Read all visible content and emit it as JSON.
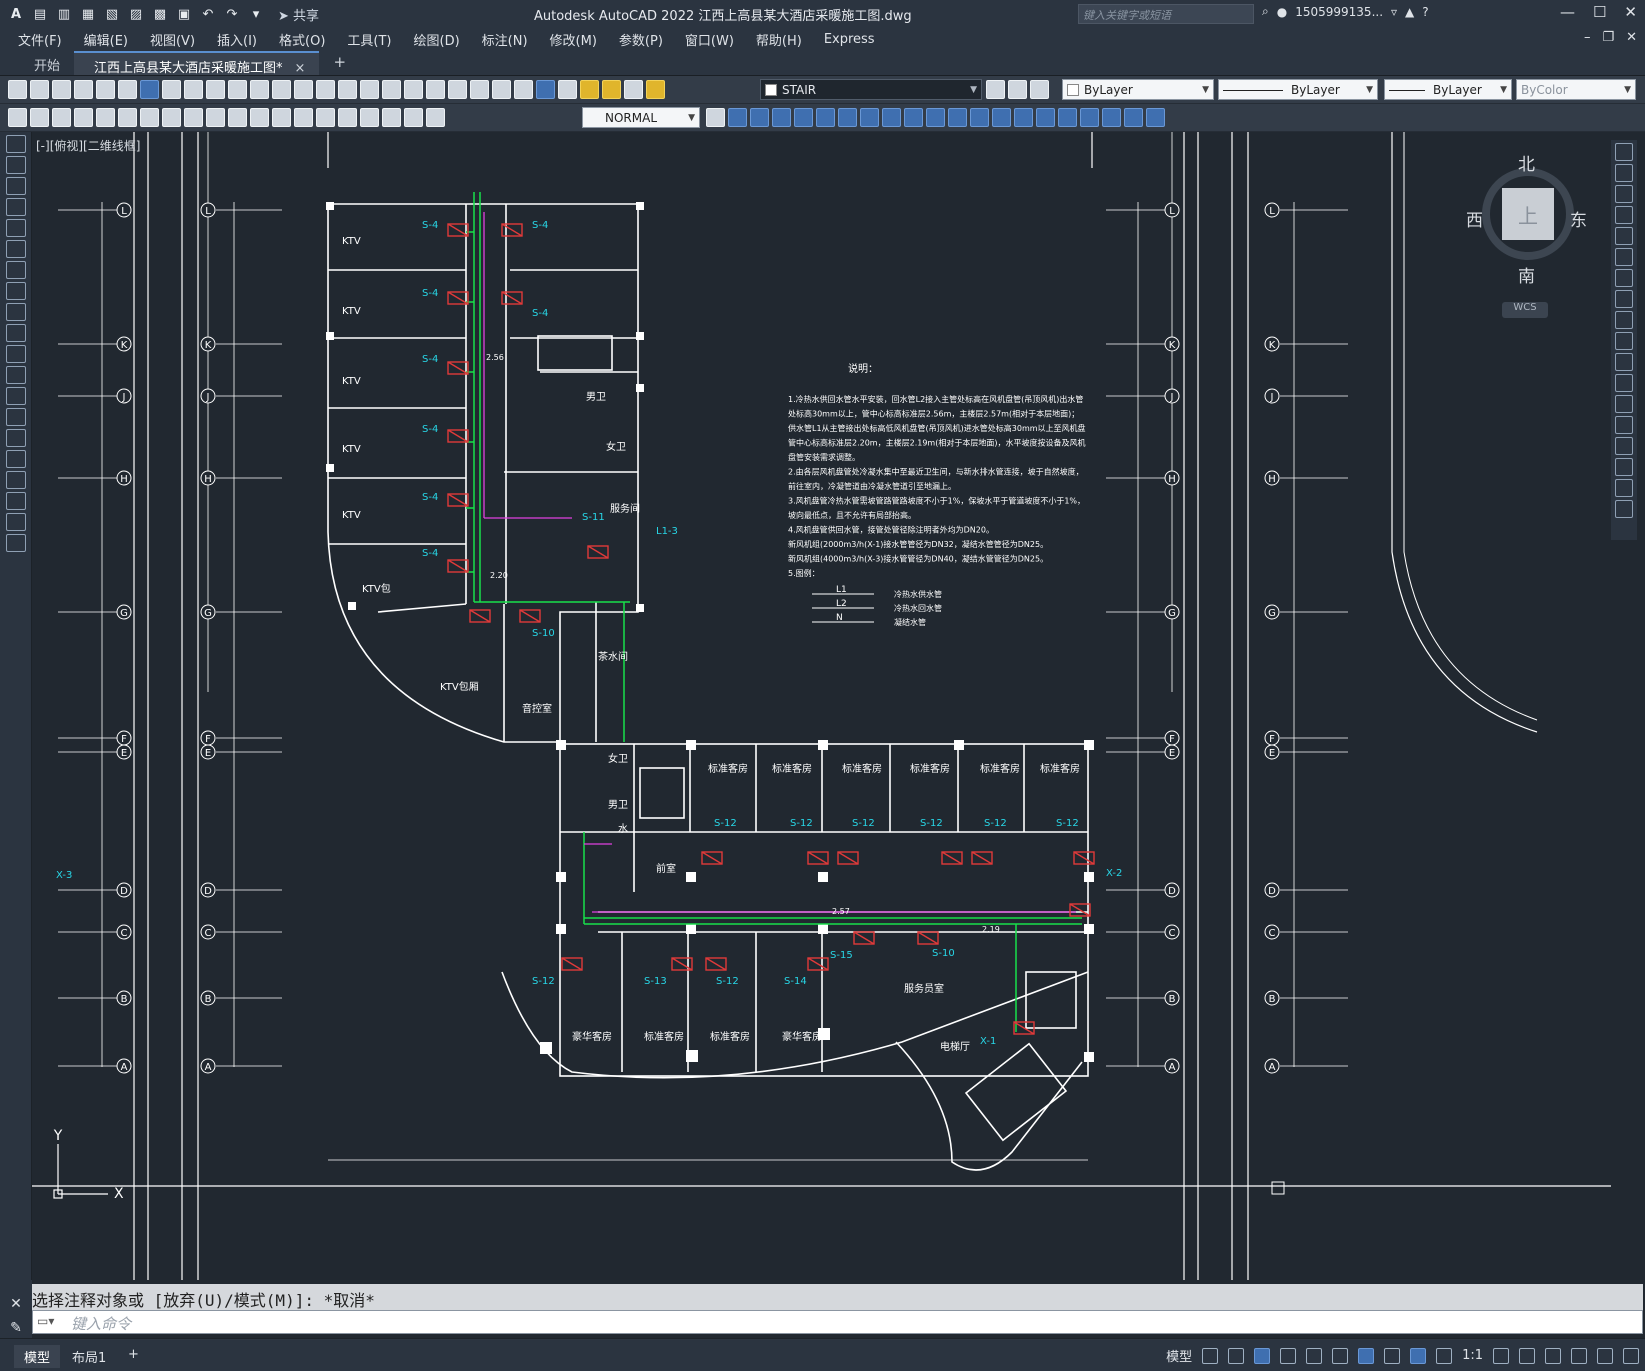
{
  "app": {
    "title": "Autodesk AutoCAD 2022    江西上高县某大酒店采暖施工图.dwg",
    "logo": "A",
    "share_label": "共享",
    "search_placeholder": "键入关键字或短语",
    "user": "1505999135...",
    "accent": "#5a8fd0"
  },
  "menu": [
    "文件(F)",
    "编辑(E)",
    "视图(V)",
    "插入(I)",
    "格式(O)",
    "工具(T)",
    "绘图(D)",
    "标注(N)",
    "修改(M)",
    "参数(P)",
    "窗口(W)",
    "帮助(H)",
    "Express"
  ],
  "tabs": {
    "start": "开始",
    "drawing": "江西上高县某大酒店采暖施工图*",
    "close": "×",
    "add": "+"
  },
  "toolbar": {
    "layer": "STAIR",
    "color": "ByLayer",
    "linetype": "ByLayer",
    "lineweight": "ByLayer",
    "plotstyle": "ByColor",
    "dimstyle": "NORMAL"
  },
  "viewport_label": "[-][俯视][二维线框]",
  "viewcube": {
    "north": "北",
    "south": "南",
    "east": "东",
    "west": "西",
    "top": "上",
    "wcs": "WCS"
  },
  "drawing": {
    "grid_left": [
      "L",
      "K",
      "J",
      "H",
      "G",
      "F",
      "E",
      "D",
      "C",
      "B",
      "A"
    ],
    "grid_right": [
      "L",
      "K",
      "J",
      "H",
      "G",
      "F",
      "E",
      "D",
      "C",
      "B",
      "A"
    ],
    "rooms_top": [
      "KTV",
      "KTV",
      "KTV",
      "KTV",
      "KTV",
      "KTV包",
      "KTV包厢",
      "音控室",
      "茶水间",
      "男卫",
      "女卫",
      "服务间"
    ],
    "rooms_bottom": [
      "标准客房",
      "标准客房",
      "标准客房",
      "标准客房",
      "标准客房",
      "标准客房",
      "前室",
      "女卫",
      "男卫",
      "水",
      "豪华客房",
      "标准客房",
      "标准客房",
      "豪华客房",
      "服务员室",
      "电梯厅"
    ],
    "tags": [
      "S-4",
      "S-4",
      "S-4",
      "S-4",
      "S-4",
      "S-4",
      "S-4",
      "S-4",
      "S-10",
      "S-11",
      "S-12",
      "S-12",
      "S-12",
      "S-12",
      "S-12",
      "S-12",
      "S-12",
      "S-12",
      "S-13",
      "S-14",
      "S-15",
      "S-10",
      "X-1",
      "X-2",
      "X-3",
      "L1-3"
    ],
    "notes_title": "说明：",
    "notes": [
      "1.冷热水供回水管水平安装，回水管L2接入主管处标高在风机盘管(吊顶风机)出水管",
      "  处标高30mm以上，管中心标高标准层2.56m，主楼层2.57m(相对于本层地面)；",
      "  供水管L1从主管接出处标高低风机盘管(吊顶风机)进水管处标高30mm以上至风机盘",
      "  管中心标高标准层2.20m，主楼层2.19m(相对于本层地面)，水平坡度按设备及风机",
      "  盘管安装需求调整。",
      "2.由各层风机盘管处冷凝水集中至最近卫生间，与新水排水管连接，坡于自然坡度，",
      "  前往室内，冷凝管道由冷凝水管道引至地漏上。",
      "3.风机盘管冷热水管需坡管路管路坡度不小于1%，保坡水平于管道坡度不小于1%，",
      "  坡向最低点，且不允许有局部抬高。",
      "4.风机盘管供回水管，接管处管径除注明者外均为DN20。",
      "  新风机组(2000m3/h(X-1)接水管管径为DN32，凝结水管管径为DN25。",
      "  新风机组(4000m3/h(X-3)接水管管径为DN40，凝结水管管径为DN25。",
      "5.图例："
    ],
    "legend": [
      {
        "code": "L1",
        "desc": "冷热水供水管"
      },
      {
        "code": "L2",
        "desc": "冷热水回水管"
      },
      {
        "code": "N",
        "desc": "凝结水管"
      }
    ],
    "elev_labels": [
      "2.57",
      "2.19",
      "2.56",
      "2.20"
    ],
    "ucs_x": "X",
    "ucs_y": "Y"
  },
  "command": {
    "history": "选择注释对象或 [放弃(U)/模式(M)]: *取消*",
    "placeholder": "键入命令"
  },
  "status": {
    "tab_model": "模型",
    "tab_layout": "布局1",
    "add": "+",
    "model_label": "模型",
    "scale": "1:1"
  },
  "colors": {
    "canvas": "#212830",
    "wall": "#ffffff",
    "pipe_green": "#19e04a",
    "pipe_magenta": "#e040e0",
    "tag_cyan": "#28d6e6",
    "unit_red": "#e03a3a"
  }
}
